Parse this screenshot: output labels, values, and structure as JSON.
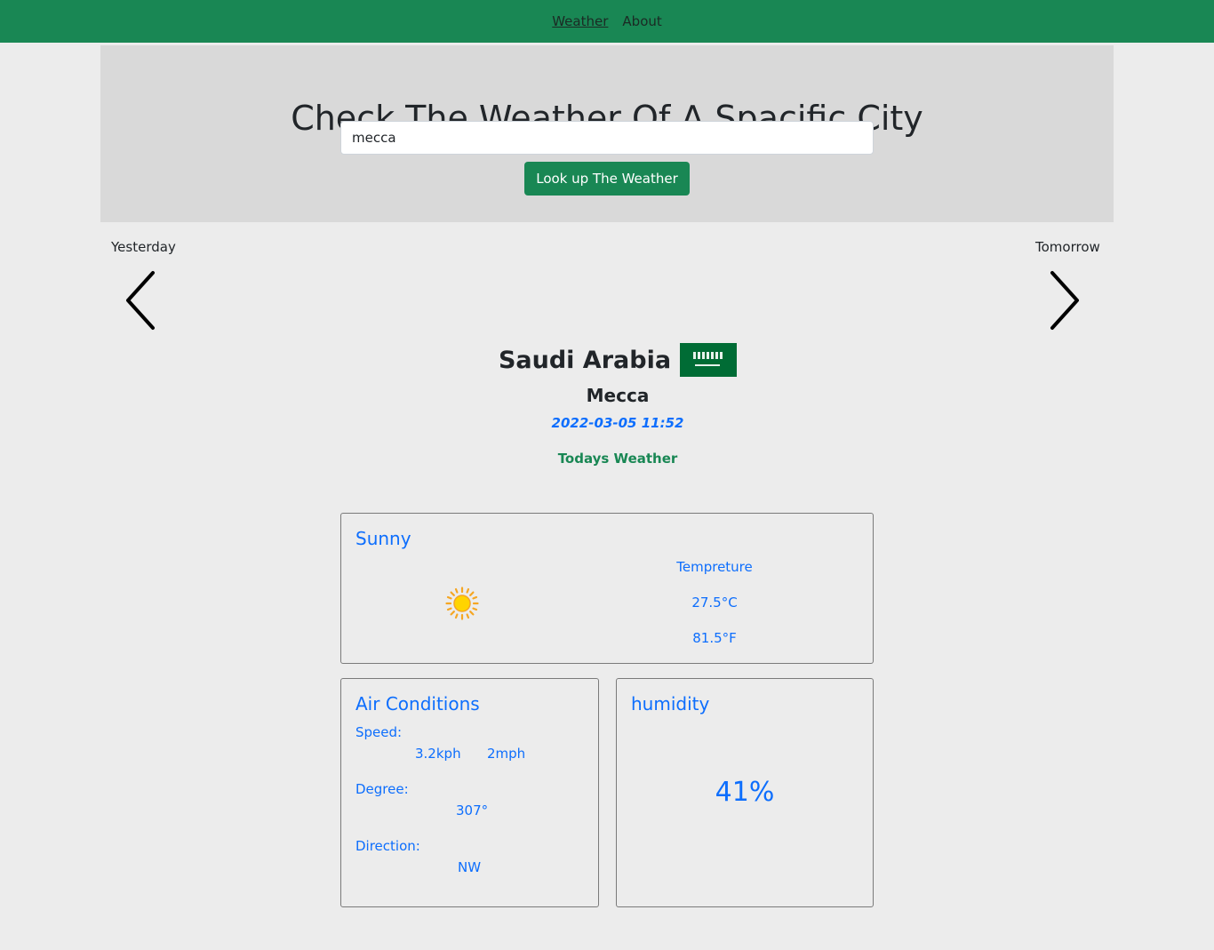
{
  "nav": {
    "links": [
      "Weather",
      "About"
    ]
  },
  "hero": {
    "title": "Check The Weather Of A Spacific City",
    "search_value": "mecca",
    "button_label": "Look up The Weather"
  },
  "day_nav": {
    "prev_label": "Yesterday",
    "next_label": "Tomorrow"
  },
  "location": {
    "country": "Saudi Arabia",
    "flag": "saudi-arabia-flag",
    "city": "Mecca",
    "datetime": "2022-03-05 11:52",
    "section_label": "Todays Weather"
  },
  "condition": {
    "title": "Sunny",
    "icon": "sun-icon",
    "temp_label": "Tempreture",
    "temp_c": "27.5°C",
    "temp_f": "81.5°F"
  },
  "air": {
    "title": "Air Conditions",
    "speed_label": "Speed:",
    "speed_kph": "3.2kph",
    "speed_mph": "2mph",
    "degree_label": "Degree:",
    "degree_value": "307°",
    "direction_label": "Direction:",
    "direction_value": "NW"
  },
  "humidity": {
    "title": "humidity",
    "value": "41%"
  },
  "colors": {
    "navbar": "#198754",
    "accent_blue": "#0d6efd",
    "accent_green": "#198754",
    "hero_bg": "#d9d9d9",
    "page_bg": "#ececec"
  }
}
